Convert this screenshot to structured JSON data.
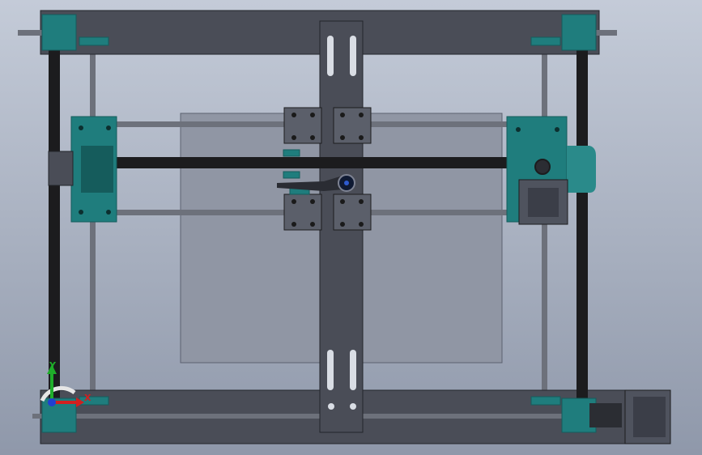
{
  "window": {
    "view": "top view"
  },
  "colors": {
    "background_top": "#c4cbd8",
    "background_bottom": "#8f98aa",
    "frame": "#4a4d57",
    "frame_edge": "#23252b",
    "rod": "#6d717b",
    "belt": "#1c1c1e",
    "bracket": "#1f7d7d",
    "bracket_dark": "#155c5c",
    "bed": "#9096a4",
    "carriage": "#5b5f6a",
    "motor": "#4f535e",
    "axis_x": "#d21f1f",
    "axis_y": "#1fae2a",
    "axis_z": "#1f3fd2"
  },
  "triad": {
    "x_label": "X",
    "y_label": "Y"
  },
  "parts": [
    "frame-top",
    "frame-bottom",
    "print-bed",
    "y-carriage-plate",
    "x-carriage",
    "belt-left",
    "belt-right",
    "belt-x",
    "x-motor",
    "y-motor"
  ]
}
